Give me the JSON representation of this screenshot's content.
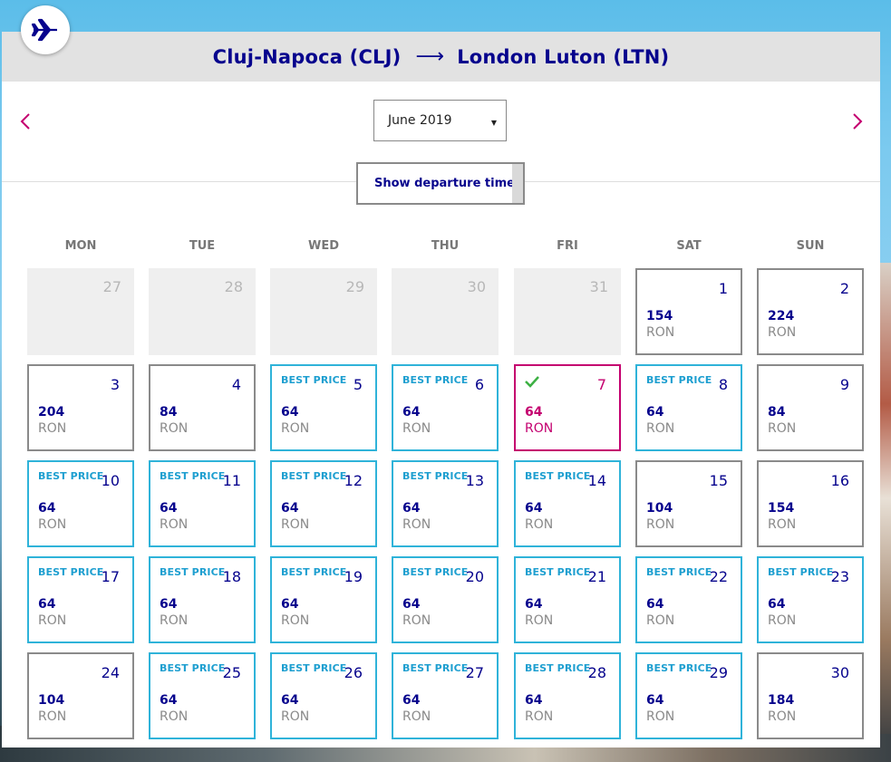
{
  "header": {
    "origin": "Cluj-Napoca (CLJ)",
    "arrow": "⟶",
    "destination": "London Luton (LTN)"
  },
  "month_selector": {
    "value": "June 2019"
  },
  "departure_times_button": {
    "label": "Show departure times"
  },
  "weekdays": [
    "MON",
    "TUE",
    "WED",
    "THU",
    "FRI",
    "SAT",
    "SUN"
  ],
  "currency": "RON",
  "best_price_label": "BEST PRICE",
  "colors": {
    "brand_navy": "#06038d",
    "accent_magenta": "#c4006f",
    "best_price_blue": "#2fb3d9",
    "check_green": "#3cb043"
  },
  "days": [
    {
      "day": "27",
      "outside_month": true
    },
    {
      "day": "28",
      "outside_month": true
    },
    {
      "day": "29",
      "outside_month": true
    },
    {
      "day": "30",
      "outside_month": true
    },
    {
      "day": "31",
      "outside_month": true
    },
    {
      "day": "1",
      "price": "154"
    },
    {
      "day": "2",
      "price": "224"
    },
    {
      "day": "3",
      "price": "204"
    },
    {
      "day": "4",
      "price": "84"
    },
    {
      "day": "5",
      "price": "64",
      "best": true
    },
    {
      "day": "6",
      "price": "64",
      "best": true
    },
    {
      "day": "7",
      "price": "64",
      "selected": true
    },
    {
      "day": "8",
      "price": "64",
      "best": true
    },
    {
      "day": "9",
      "price": "84"
    },
    {
      "day": "10",
      "price": "64",
      "best": true
    },
    {
      "day": "11",
      "price": "64",
      "best": true
    },
    {
      "day": "12",
      "price": "64",
      "best": true
    },
    {
      "day": "13",
      "price": "64",
      "best": true
    },
    {
      "day": "14",
      "price": "64",
      "best": true
    },
    {
      "day": "15",
      "price": "104"
    },
    {
      "day": "16",
      "price": "154"
    },
    {
      "day": "17",
      "price": "64",
      "best": true
    },
    {
      "day": "18",
      "price": "64",
      "best": true
    },
    {
      "day": "19",
      "price": "64",
      "best": true
    },
    {
      "day": "20",
      "price": "64",
      "best": true
    },
    {
      "day": "21",
      "price": "64",
      "best": true
    },
    {
      "day": "22",
      "price": "64",
      "best": true
    },
    {
      "day": "23",
      "price": "64",
      "best": true
    },
    {
      "day": "24",
      "price": "104"
    },
    {
      "day": "25",
      "price": "64",
      "best": true
    },
    {
      "day": "26",
      "price": "64",
      "best": true
    },
    {
      "day": "27",
      "price": "64",
      "best": true
    },
    {
      "day": "28",
      "price": "64",
      "best": true
    },
    {
      "day": "29",
      "price": "64",
      "best": true
    },
    {
      "day": "30",
      "price": "184"
    }
  ]
}
